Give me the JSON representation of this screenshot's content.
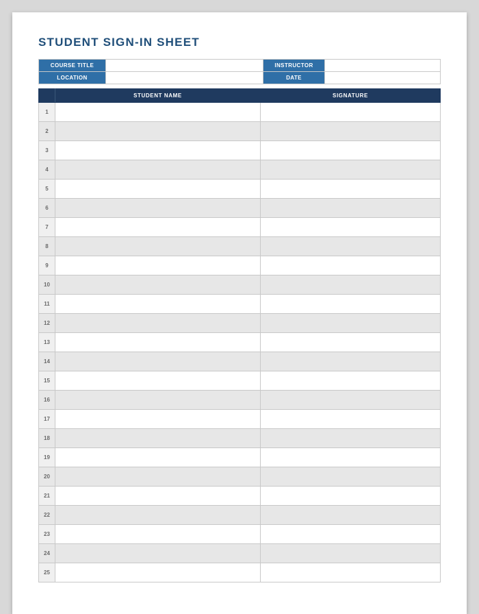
{
  "title": "STUDENT SIGN-IN SHEET",
  "meta": {
    "course_title_label": "COURSE TITLE",
    "course_title_value": "",
    "instructor_label": "INSTRUCTOR",
    "instructor_value": "",
    "location_label": "LOCATION",
    "location_value": "",
    "date_label": "DATE",
    "date_value": ""
  },
  "headers": {
    "num": "",
    "student_name": "STUDENT NAME",
    "signature": "SIGNATURE"
  },
  "rows": [
    {
      "n": "1",
      "name": "",
      "sig": ""
    },
    {
      "n": "2",
      "name": "",
      "sig": ""
    },
    {
      "n": "3",
      "name": "",
      "sig": ""
    },
    {
      "n": "4",
      "name": "",
      "sig": ""
    },
    {
      "n": "5",
      "name": "",
      "sig": ""
    },
    {
      "n": "6",
      "name": "",
      "sig": ""
    },
    {
      "n": "7",
      "name": "",
      "sig": ""
    },
    {
      "n": "8",
      "name": "",
      "sig": ""
    },
    {
      "n": "9",
      "name": "",
      "sig": ""
    },
    {
      "n": "10",
      "name": "",
      "sig": ""
    },
    {
      "n": "11",
      "name": "",
      "sig": ""
    },
    {
      "n": "12",
      "name": "",
      "sig": ""
    },
    {
      "n": "13",
      "name": "",
      "sig": ""
    },
    {
      "n": "14",
      "name": "",
      "sig": ""
    },
    {
      "n": "15",
      "name": "",
      "sig": ""
    },
    {
      "n": "16",
      "name": "",
      "sig": ""
    },
    {
      "n": "17",
      "name": "",
      "sig": ""
    },
    {
      "n": "18",
      "name": "",
      "sig": ""
    },
    {
      "n": "19",
      "name": "",
      "sig": ""
    },
    {
      "n": "20",
      "name": "",
      "sig": ""
    },
    {
      "n": "21",
      "name": "",
      "sig": ""
    },
    {
      "n": "22",
      "name": "",
      "sig": ""
    },
    {
      "n": "23",
      "name": "",
      "sig": ""
    },
    {
      "n": "24",
      "name": "",
      "sig": ""
    },
    {
      "n": "25",
      "name": "",
      "sig": ""
    }
  ]
}
